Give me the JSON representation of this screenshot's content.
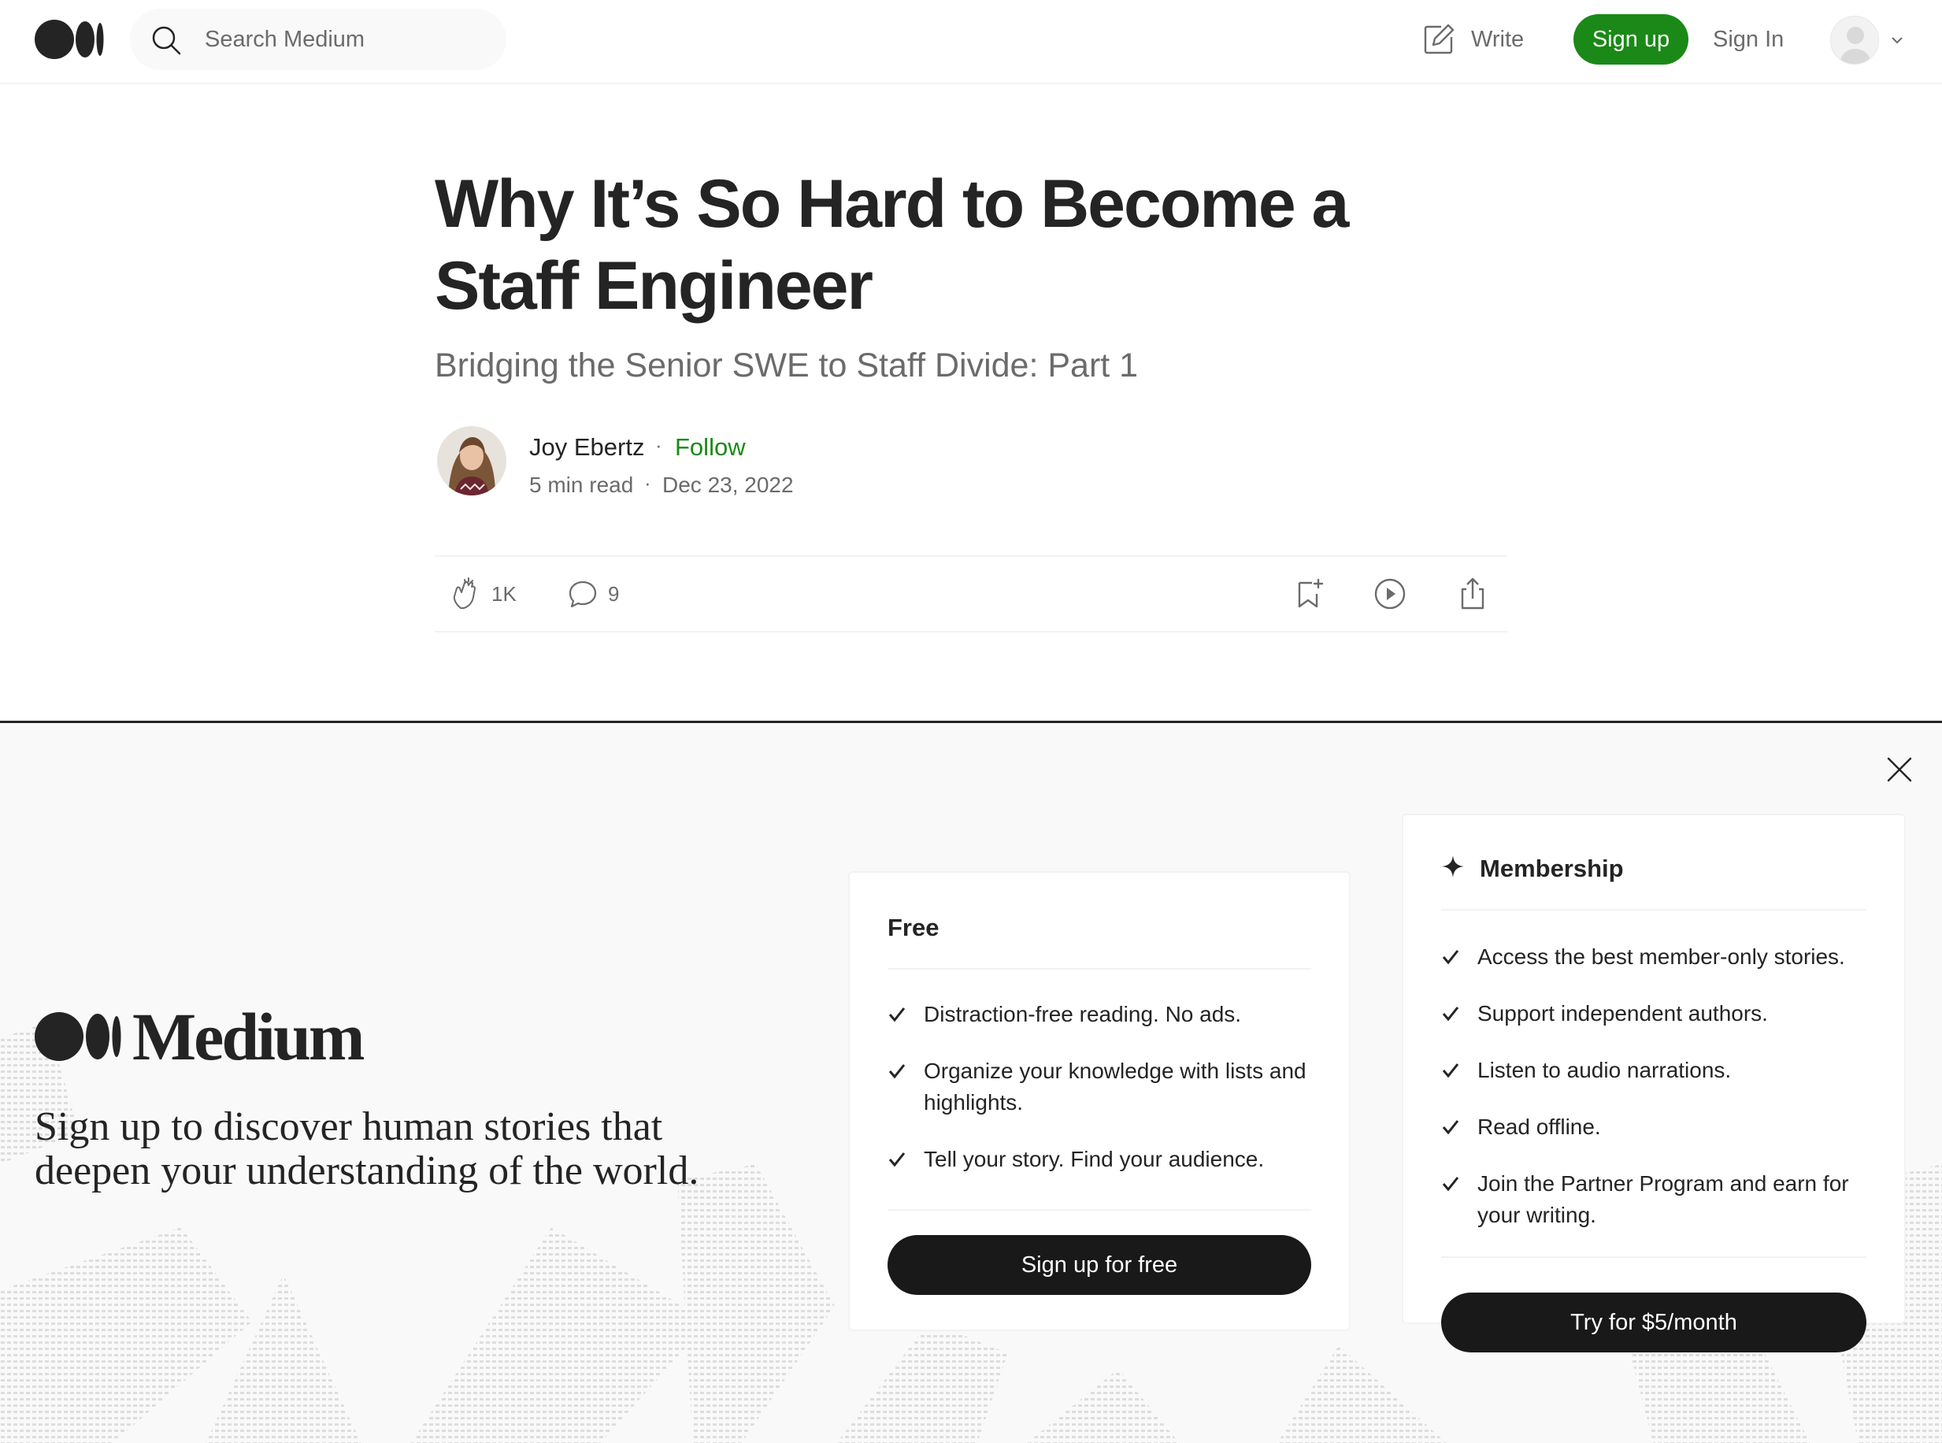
{
  "nav": {
    "search_placeholder": "Search Medium",
    "write_label": "Write",
    "signup_label": "Sign up",
    "signin_label": "Sign In"
  },
  "article": {
    "title": "Why It’s So Hard to Become a Staff Engineer",
    "subtitle": "Bridging the Senior SWE to Staff Divide: Part 1",
    "author": "Joy Ebertz",
    "follow_label": "Follow",
    "read_time": "5 min read",
    "date": "Dec 23, 2022",
    "claps": "1K",
    "responses": "9"
  },
  "overlay": {
    "brand": "Medium",
    "tagline": "Sign up to discover human stories that deepen your understanding of the world.",
    "free": {
      "title": "Free",
      "features": [
        "Distraction-free reading. No ads.",
        "Organize your knowledge with lists and highlights.",
        "Tell your story. Find your audience."
      ],
      "cta": "Sign up for free"
    },
    "membership": {
      "title": "Membership",
      "features": [
        "Access the best member-only stories.",
        "Support independent authors.",
        "Listen to audio narrations.",
        "Read offline.",
        "Join the Partner Program and earn for your writing."
      ],
      "cta": "Try for $5/month"
    }
  },
  "colors": {
    "accent_green": "#1a8917",
    "text_primary": "#242424",
    "text_secondary": "#6b6b6b",
    "button_dark": "#191919"
  },
  "icons": [
    "medium-logo-icon",
    "search-icon",
    "write-icon",
    "user-avatar-icon",
    "chevron-down-icon",
    "clap-icon",
    "comment-icon",
    "bookmark-icon",
    "play-icon",
    "share-icon",
    "close-icon",
    "sparkle-icon",
    "check-icon"
  ]
}
